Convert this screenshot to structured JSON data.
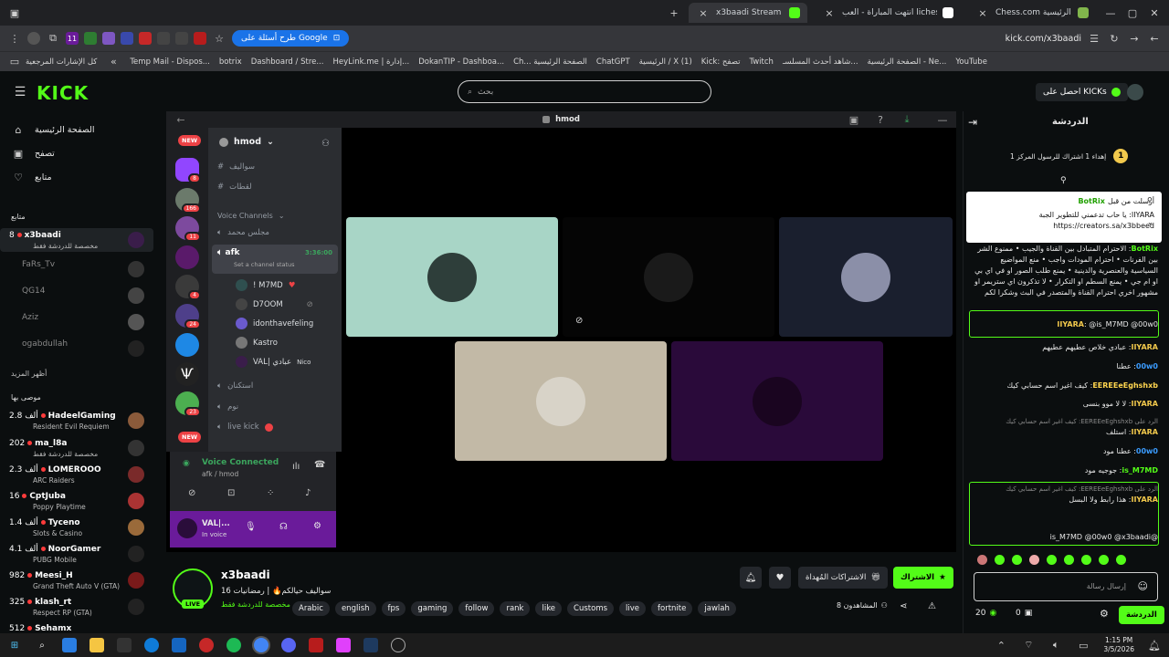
{
  "browser": {
    "tabs": [
      {
        "label": "x3baadi Stream - Watch Live on",
        "active": true
      },
      {
        "label": "انتهت المباراة - العب lichess.org"
      },
      {
        "label": "Chess.com الصفحة الرئيسية"
      }
    ],
    "address": "kick.com/x3baadi",
    "omnibox_prompt": "طرح أسئلة على Google",
    "bookmarks": [
      "كل الإشارات المرجعية",
      "Temp Mail - Dispos...",
      "botrix",
      "Dashboard / Stre...",
      "HeyLink.me | إدارة...",
      "DokanTIP - Dashboa...",
      "Ch... الصفحة الرئيسية",
      "ChatGPT",
      "الرئيسية / X (1)",
      "Kick: تصفح",
      "Twitch",
      "شاهد أحدث المسلسـ...",
      "الصفحة الرئيسية - Ne...",
      "YouTube"
    ]
  },
  "kick": {
    "logo": "KICK",
    "search_placeholder": "بحث",
    "get_kicks": "احصل على KICKs"
  },
  "sidebar": {
    "nav": [
      {
        "label": "الصفحة الرئيسية",
        "icon": "home-icon"
      },
      {
        "label": "تصفح",
        "icon": "browse-icon"
      },
      {
        "label": "متابع",
        "icon": "heart-icon"
      }
    ],
    "following_title": "متابع",
    "following": [
      {
        "name": "x3baadi",
        "viewers": "8",
        "game": "مخصصة للدردشة فقط",
        "live": true
      },
      {
        "name": "FaRs_Tv"
      },
      {
        "name": "QG14"
      },
      {
        "name": "Aziz"
      },
      {
        "name": "ogabdullah"
      }
    ],
    "show_more": "أظهر المزيد",
    "recommended_title": "موصى بها",
    "recommended": [
      {
        "viewers": "2.8 ألف",
        "name": "HadeelGaming",
        "game": "Resident Evil Requiem"
      },
      {
        "viewers": "202",
        "name": "ma_l8a",
        "game": "مخصصة للدردشة فقط"
      },
      {
        "viewers": "2.3 ألف",
        "name": "LOMEROOO",
        "game": "ARC Raiders"
      },
      {
        "viewers": "16",
        "name": "CptJuba",
        "game": "Poppy Playtime"
      },
      {
        "viewers": "1.4 ألف",
        "name": "Tyceno",
        "game": "Slots & Casino"
      },
      {
        "viewers": "4.1 ألف",
        "name": "NoorGamer",
        "game": "PUBG Mobile"
      },
      {
        "viewers": "982",
        "name": "Meesi_H",
        "game": "Grand Theft Auto V (GTA)"
      },
      {
        "viewers": "325",
        "name": "klash_rt",
        "game": "Respect RP (GTA)"
      },
      {
        "viewers": "512",
        "name": "Sehamx"
      }
    ]
  },
  "discord": {
    "server": "hmod",
    "new_badge": "NEW",
    "badges": [
      "8",
      "166",
      "11",
      "4",
      "24",
      "23"
    ],
    "text_channels": [
      "سواليف",
      "لقطات"
    ],
    "voice_section": "Voice Channels",
    "voice_channels": [
      {
        "name": "مجلس محمد"
      },
      {
        "name": "afk",
        "time": "3:36:00",
        "status": "Set a channel status"
      },
      {
        "name": "استكنان"
      },
      {
        "name": "نوم"
      },
      {
        "name": "live kick"
      }
    ],
    "afk_users": [
      "! M7MD",
      "D7OOM",
      "idonthavefeling",
      "Kastro",
      "VAL| عبادي"
    ],
    "val_tag": "Nico",
    "voice_connected": "Voice Connected",
    "voice_path": "afk / hmod",
    "user": {
      "name": "VAL|...",
      "status": "In voice"
    }
  },
  "chat": {
    "title": "الدردشة",
    "pinned": "إهداء 1 اشتراك للرسول المركز 1",
    "messages": [
      {
        "user": "BotRix",
        "color": "#53fc18",
        "text": "IIYARA: يا حاب تدعمني للتطوير الجبة https://creators.sa/x3bbeed",
        "pre": "أرسلت من قبل"
      },
      {
        "user": "BotRix",
        "color": "#53fc18",
        "text": "الاحترام المتبادل بين القناة والجيب • ممنوع الشر بين الفرنات • احترام المودات واجب • منع المواضيع السياسية والعنصرية والدينية • يمنع طلب الصور او في اي بي او ام جي • يمنع السطم او التكرار • لا تذكرون اي ستريمر او مشهور اخري احترام القناة والمتصدر في البث وشكرا لكم"
      },
      {
        "user": "IIYARA",
        "color": "#f2c94c",
        "text": "@is_M7MD @00w0"
      },
      {
        "user": "IIYARA",
        "color": "#f2c94c",
        "text": "عبادي خلاص عطيهم عطيهم"
      },
      {
        "user": "00w0",
        "color": "#3b9cff",
        "text": "عطنا"
      },
      {
        "user": "EEREEeEghshxb",
        "color": "#ffd54f",
        "text": "كيف اغير اسم حسابي كيك"
      },
      {
        "user": "IIYARA",
        "color": "#f2c94c",
        "text": "لا لا موو بنسى"
      },
      {
        "user": "IIYARA",
        "color": "#f2c94c",
        "text": "استلف",
        "pre": "الرد على EEREEeEghshxb: كيف اغير اسم حسابي كيك"
      },
      {
        "user": "00w0",
        "color": "#3b9cff",
        "text": "عطنا مود"
      },
      {
        "user": "is_M7MD",
        "color": "#53fc18",
        "text": "جوجيه مود"
      },
      {
        "user": "IIYARA",
        "color": "#f2c94c",
        "text": "هذا رابط ولا البسل",
        "pre": "الرد على EEREEeEghshxb: كيف اغير اسم حسابي كيك"
      }
    ],
    "last_line": "@is_M7MD @00w0 @x3baadi",
    "send_placeholder": "إرسال رسالة",
    "chat_button": "الدردشة",
    "points": "0",
    "kicks": "20"
  },
  "streamer": {
    "name": "x3baadi",
    "title": "سواليف حيالكم🔥 | رمضانيات 16",
    "category": "مخصصة للدردشة فقط",
    "live_label": "LIVE",
    "viewers": "8 المشاهدون",
    "subscribe": "الاشتراك",
    "gift": "الاشتراكات المُهداة",
    "tags": [
      "Arabic",
      "english",
      "fps",
      "gaming",
      "follow",
      "rank",
      "like",
      "Customs",
      "live",
      "fortnite",
      "jawlah"
    ]
  },
  "taskbar": {
    "time": "1:15 PM",
    "date": "3/5/2026"
  }
}
